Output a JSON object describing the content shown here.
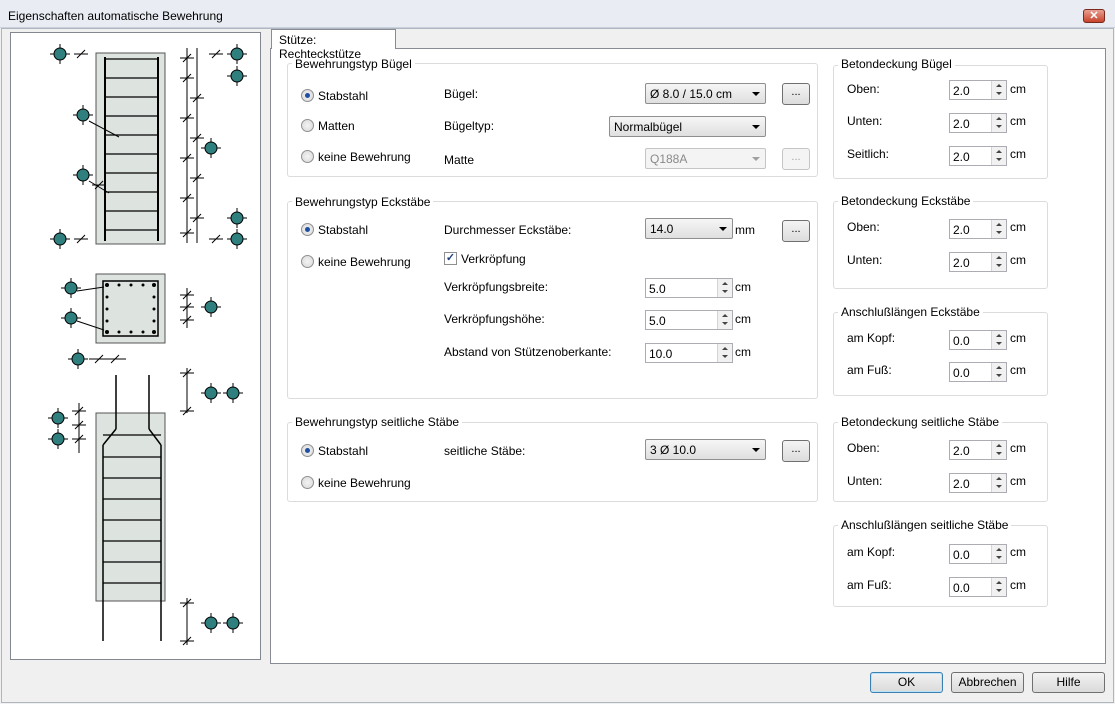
{
  "window": {
    "title": "Eigenschaften automatische Bewehrung",
    "close_label": "✕"
  },
  "tab": {
    "label": "Stütze: Rechteckstütze"
  },
  "buegel": {
    "title": "Bewehrungstyp Bügel",
    "options": [
      "Stabstahl",
      "Matten",
      "keine Bewehrung"
    ],
    "selected": "Stabstahl",
    "buegel_label": "Bügel:",
    "buegel_value": "Ø 8.0 / 15.0 cm",
    "typ_label": "Bügeltyp:",
    "typ_value": "Normalbügel",
    "matte_label": "Matte",
    "matte_value": "Q188A",
    "more": "..."
  },
  "eck": {
    "title": "Bewehrungstyp Eckstäbe",
    "options": [
      "Stabstahl",
      "keine Bewehrung"
    ],
    "selected": "Stabstahl",
    "durchmesser_label": "Durchmesser Eckstäbe:",
    "durchmesser_value": "14.0",
    "durchmesser_unit": "mm",
    "verkroepfung_label": "Verkröpfung",
    "verkroepfung_checked": true,
    "breite_label": "Verkröpfungsbreite:",
    "breite_value": "5.0",
    "hoehe_label": "Verkröpfungshöhe:",
    "hoehe_value": "5.0",
    "abstand_label": "Abstand von Stützenoberkante:",
    "abstand_value": "10.0",
    "unit": "cm",
    "more": "..."
  },
  "seit": {
    "title": "Bewehrungstyp seitliche Stäbe",
    "options": [
      "Stabstahl",
      "keine Bewehrung"
    ],
    "selected": "Stabstahl",
    "staebe_label": "seitliche Stäbe:",
    "staebe_value": "3 Ø 10.0",
    "more": "..."
  },
  "right": {
    "unit": "cm",
    "bet_buegel": {
      "title": "Betondeckung Bügel",
      "oben_label": "Oben:",
      "oben": "2.0",
      "unten_label": "Unten:",
      "unten": "2.0",
      "seit_label": "Seitlich:",
      "seit": "2.0"
    },
    "bet_eck": {
      "title": "Betondeckung Eckstäbe",
      "oben_label": "Oben:",
      "oben": "2.0",
      "unten_label": "Unten:",
      "unten": "2.0"
    },
    "ansch_eck": {
      "title": "Anschlußlängen Eckstäbe",
      "kopf_label": "am Kopf:",
      "kopf": "0.0",
      "fuss_label": "am Fuß:",
      "fuss": "0.0"
    },
    "bet_seit": {
      "title": "Betondeckung seitliche Stäbe",
      "oben_label": "Oben:",
      "oben": "2.0",
      "unten_label": "Unten:",
      "unten": "2.0"
    },
    "ansch_seit": {
      "title": "Anschlußlängen seitliche Stäbe",
      "kopf_label": "am Kopf:",
      "kopf": "0.0",
      "fuss_label": "am Fuß:",
      "fuss": "0.0"
    }
  },
  "buttons": {
    "ok": "OK",
    "cancel": "Abbrechen",
    "help": "Hilfe"
  },
  "colors": {
    "concrete": "#dde3df",
    "marker": "#2f7f7f"
  }
}
